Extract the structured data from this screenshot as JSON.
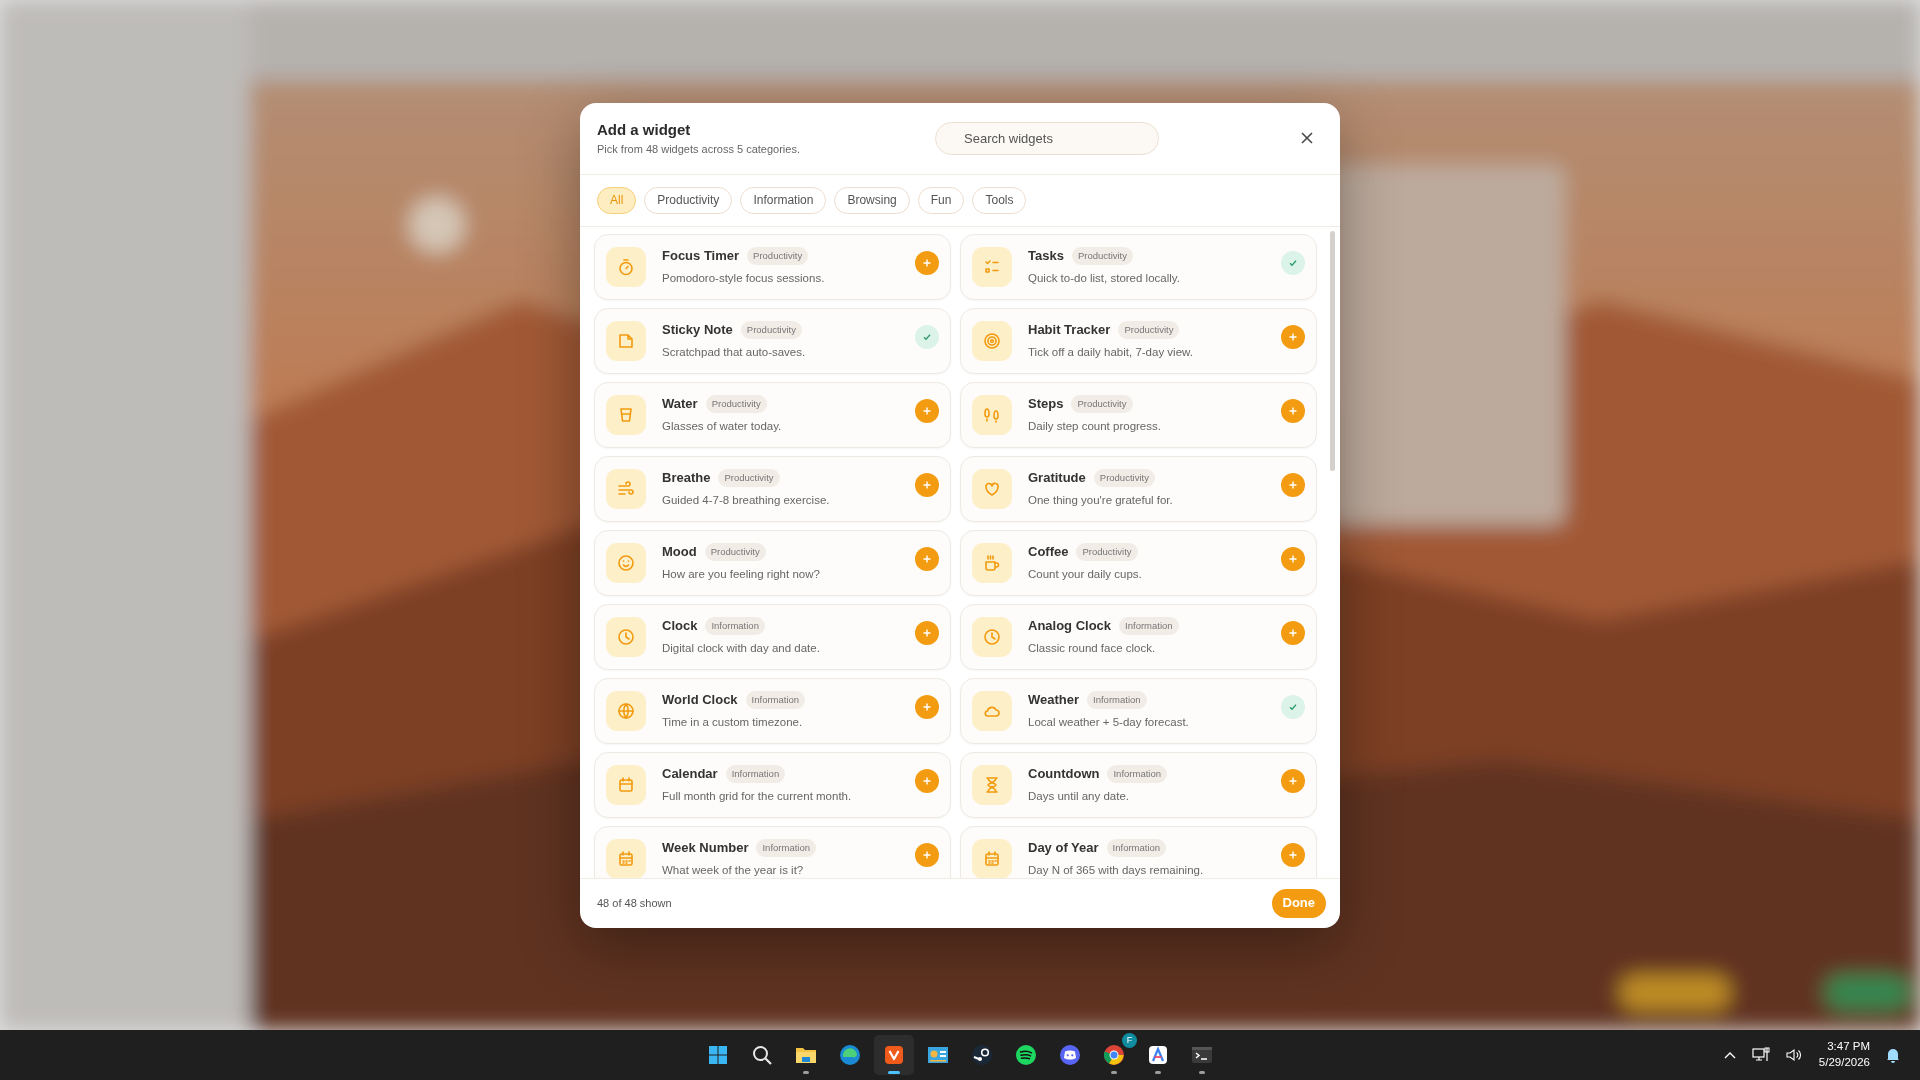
{
  "dialog": {
    "title": "Add a widget",
    "subtitle": "Pick from 48 widgets across 5 categories.",
    "search": {
      "placeholder": "Search widgets"
    }
  },
  "tabs": [
    {
      "label": "All",
      "selected": true
    },
    {
      "label": "Productivity",
      "selected": false
    },
    {
      "label": "Information",
      "selected": false
    },
    {
      "label": "Browsing",
      "selected": false
    },
    {
      "label": "Fun",
      "selected": false
    },
    {
      "label": "Tools",
      "selected": false
    }
  ],
  "widgets": [
    {
      "name": "Focus Timer",
      "category": "Productivity",
      "description": "Pomodoro-style focus sessions.",
      "added": false
    },
    {
      "name": "Tasks",
      "category": "Productivity",
      "description": "Quick to-do list, stored locally.",
      "added": true
    },
    {
      "name": "Sticky Note",
      "category": "Productivity",
      "description": "Scratchpad that auto-saves.",
      "added": true
    },
    {
      "name": "Habit Tracker",
      "category": "Productivity",
      "description": "Tick off a daily habit, 7-day view.",
      "added": false
    },
    {
      "name": "Water",
      "category": "Productivity",
      "description": "Glasses of water today.",
      "added": false
    },
    {
      "name": "Steps",
      "category": "Productivity",
      "description": "Daily step count progress.",
      "added": false
    },
    {
      "name": "Breathe",
      "category": "Productivity",
      "description": "Guided 4-7-8 breathing exercise.",
      "added": false
    },
    {
      "name": "Gratitude",
      "category": "Productivity",
      "description": "One thing you're grateful for.",
      "added": false
    },
    {
      "name": "Mood",
      "category": "Productivity",
      "description": "How are you feeling right now?",
      "added": false
    },
    {
      "name": "Coffee",
      "category": "Productivity",
      "description": "Count your daily cups.",
      "added": false
    },
    {
      "name": "Clock",
      "category": "Information",
      "description": "Digital clock with day and date.",
      "added": false
    },
    {
      "name": "Analog Clock",
      "category": "Information",
      "description": "Classic round face clock.",
      "added": false
    },
    {
      "name": "World Clock",
      "category": "Information",
      "description": "Time in a custom timezone.",
      "added": false
    },
    {
      "name": "Weather",
      "category": "Information",
      "description": "Local weather + 5-day forecast.",
      "added": true
    },
    {
      "name": "Calendar",
      "category": "Information",
      "description": "Full month grid for the current month.",
      "added": false
    },
    {
      "name": "Countdown",
      "category": "Information",
      "description": "Days until any date.",
      "added": false
    },
    {
      "name": "Week Number",
      "category": "Information",
      "description": "What week of the year is it?",
      "added": false
    },
    {
      "name": "Day of Year",
      "category": "Information",
      "description": "Day N of 365 with days remaining.",
      "added": false
    }
  ],
  "footer": {
    "count": "48 of 48 shown",
    "done": "Done"
  },
  "taskbar": {
    "apps": [
      {
        "running": false,
        "active": false
      },
      {
        "running": false,
        "active": false
      },
      {
        "running": true,
        "active": false
      },
      {
        "running": false,
        "active": false
      },
      {
        "running": true,
        "active": true
      },
      {
        "running": false,
        "active": false
      },
      {
        "running": false,
        "active": false
      },
      {
        "running": false,
        "active": false
      },
      {
        "running": false,
        "active": false
      },
      {
        "running": true,
        "active": false,
        "badge": "F"
      },
      {
        "running": true,
        "active": false
      },
      {
        "running": true,
        "active": false
      }
    ],
    "clock": {
      "time": "3:47 PM",
      "date": "5/29/2026"
    }
  }
}
